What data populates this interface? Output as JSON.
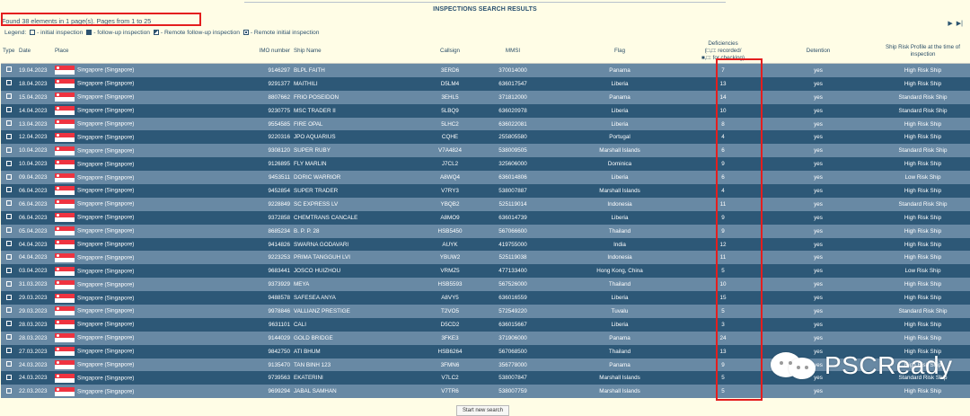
{
  "page_title": "INSPECTIONS SEARCH RESULTS",
  "summary": "Found 38 elements in 1 page(s). Pages from 1 to 25",
  "pager": {
    "next": "▶",
    "last": "▶|"
  },
  "legend": {
    "prefix": "Legend:",
    "items": [
      "- initial inspection",
      "- follow-up inspection",
      "- Remote follow-up inspection",
      "- Remote initial inspection"
    ]
  },
  "headers": {
    "type": "Type",
    "date": "Date",
    "place": "Place",
    "imo": "IMO number",
    "ship": "Ship Name",
    "callsign": "Callsign",
    "mmsi": "MMSI",
    "flag": "Flag",
    "deficiencies_1": "Deficiencies",
    "deficiencies_2": "(□,□: recorded/",
    "deficiencies_3": "■,□: for checking)",
    "detention": "Detention",
    "risk": "Ship Risk Profile at the time of inspection"
  },
  "rows": [
    {
      "date": "19.04.2023",
      "place": "Singapore (Singapore)",
      "imo": "9146297",
      "ship": "BLPL FAITH",
      "callsign": "3ERD6",
      "mmsi": "370014000",
      "flag": "Panama",
      "deficiencies": "7",
      "detention": "yes",
      "risk": "High Risk Ship"
    },
    {
      "date": "18.04.2023",
      "place": "Singapore (Singapore)",
      "imo": "9291377",
      "ship": "MAITHILI",
      "callsign": "D5LM4",
      "mmsi": "636017547",
      "flag": "Liberia",
      "deficiencies": "13",
      "detention": "yes",
      "risk": "High Risk Ship"
    },
    {
      "date": "15.04.2023",
      "place": "Singapore (Singapore)",
      "imo": "8807662",
      "ship": "FRIO POSEIDON",
      "callsign": "3EHL5",
      "mmsi": "371812000",
      "flag": "Panama",
      "deficiencies": "14",
      "detention": "yes",
      "risk": "Standard Risk Ship"
    },
    {
      "date": "14.04.2023",
      "place": "Singapore (Singapore)",
      "imo": "9230775",
      "ship": "MSC TRADER II",
      "callsign": "5LBQ9",
      "mmsi": "636020978",
      "flag": "Liberia",
      "deficiencies": "10",
      "detention": "yes",
      "risk": "Standard Risk Ship"
    },
    {
      "date": "13.04.2023",
      "place": "Singapore (Singapore)",
      "imo": "9554585",
      "ship": "FIRE OPAL",
      "callsign": "5LHC2",
      "mmsi": "636022081",
      "flag": "Liberia",
      "deficiencies": "8",
      "detention": "yes",
      "risk": "High Risk Ship"
    },
    {
      "date": "12.04.2023",
      "place": "Singapore (Singapore)",
      "imo": "9220316",
      "ship": "JPO AQUARIUS",
      "callsign": "CQHE",
      "mmsi": "255805580",
      "flag": "Portugal",
      "deficiencies": "4",
      "detention": "yes",
      "risk": "High Risk Ship"
    },
    {
      "date": "10.04.2023",
      "place": "Singapore (Singapore)",
      "imo": "9308120",
      "ship": "SUPER RUBY",
      "callsign": "V7A4824",
      "mmsi": "538009505",
      "flag": "Marshall Islands",
      "deficiencies": "6",
      "detention": "yes",
      "risk": "Standard Risk Ship"
    },
    {
      "date": "10.04.2023",
      "place": "Singapore (Singapore)",
      "imo": "9126895",
      "ship": "FLY MARLIN",
      "callsign": "J7CL2",
      "mmsi": "325606000",
      "flag": "Dominica",
      "deficiencies": "9",
      "detention": "yes",
      "risk": "High Risk Ship"
    },
    {
      "date": "09.04.2023",
      "place": "Singapore (Singapore)",
      "imo": "9453511",
      "ship": "DORIC WARRIOR",
      "callsign": "A8WQ4",
      "mmsi": "636014806",
      "flag": "Liberia",
      "deficiencies": "6",
      "detention": "yes",
      "risk": "Low Risk Ship"
    },
    {
      "date": "06.04.2023",
      "place": "Singapore (Singapore)",
      "imo": "9452854",
      "ship": "SUPER TRADER",
      "callsign": "V7RY3",
      "mmsi": "538007887",
      "flag": "Marshall Islands",
      "deficiencies": "4",
      "detention": "yes",
      "risk": "High Risk Ship"
    },
    {
      "date": "06.04.2023",
      "place": "Singapore (Singapore)",
      "imo": "9228849",
      "ship": "SC EXPRESS LV",
      "callsign": "YBQB2",
      "mmsi": "525119014",
      "flag": "Indonesia",
      "deficiencies": "11",
      "detention": "yes",
      "risk": "Standard Risk Ship"
    },
    {
      "date": "06.04.2023",
      "place": "Singapore (Singapore)",
      "imo": "9372858",
      "ship": "CHEMTRANS CANCALE",
      "callsign": "A8MO9",
      "mmsi": "636014739",
      "flag": "Liberia",
      "deficiencies": "9",
      "detention": "yes",
      "risk": "High Risk Ship"
    },
    {
      "date": "05.04.2023",
      "place": "Singapore (Singapore)",
      "imo": "8685234",
      "ship": "B. P. P. 28",
      "callsign": "HSB5450",
      "mmsi": "567066600",
      "flag": "Thailand",
      "deficiencies": "9",
      "detention": "yes",
      "risk": "High Risk Ship"
    },
    {
      "date": "04.04.2023",
      "place": "Singapore (Singapore)",
      "imo": "9414826",
      "ship": "SWARNA GODAVARI",
      "callsign": "AUYK",
      "mmsi": "419755000",
      "flag": "India",
      "deficiencies": "12",
      "detention": "yes",
      "risk": "High Risk Ship"
    },
    {
      "date": "04.04.2023",
      "place": "Singapore (Singapore)",
      "imo": "9223253",
      "ship": "PRIMA TANGGUH LVI",
      "callsign": "YBUW2",
      "mmsi": "525119038",
      "flag": "Indonesia",
      "deficiencies": "11",
      "detention": "yes",
      "risk": "High Risk Ship"
    },
    {
      "date": "03.04.2023",
      "place": "Singapore (Singapore)",
      "imo": "9683441",
      "ship": "JOSCO HUIZHOU",
      "callsign": "VRMZ5",
      "mmsi": "477133400",
      "flag": "Hong Kong, China",
      "deficiencies": "5",
      "detention": "yes",
      "risk": "Low Risk Ship"
    },
    {
      "date": "31.03.2023",
      "place": "Singapore (Singapore)",
      "imo": "9373929",
      "ship": "MEYA",
      "callsign": "HSB5593",
      "mmsi": "567526000",
      "flag": "Thailand",
      "deficiencies": "10",
      "detention": "yes",
      "risk": "High Risk Ship"
    },
    {
      "date": "29.03.2023",
      "place": "Singapore (Singapore)",
      "imo": "9488578",
      "ship": "SAFESEA ANYA",
      "callsign": "A8VY5",
      "mmsi": "636016559",
      "flag": "Liberia",
      "deficiencies": "15",
      "detention": "yes",
      "risk": "High Risk Ship"
    },
    {
      "date": "29.03.2023",
      "place": "Singapore (Singapore)",
      "imo": "9978846",
      "ship": "VALLIANZ PRESTIGE",
      "callsign": "T2VO5",
      "mmsi": "572549220",
      "flag": "Tuvalu",
      "deficiencies": "5",
      "detention": "yes",
      "risk": "Standard Risk Ship"
    },
    {
      "date": "28.03.2023",
      "place": "Singapore (Singapore)",
      "imo": "9631101",
      "ship": "CALI",
      "callsign": "D5CD2",
      "mmsi": "636015667",
      "flag": "Liberia",
      "deficiencies": "3",
      "detention": "yes",
      "risk": "High Risk Ship"
    },
    {
      "date": "28.03.2023",
      "place": "Singapore (Singapore)",
      "imo": "9144029",
      "ship": "GOLD BRIDGE",
      "callsign": "3FKE3",
      "mmsi": "371906000",
      "flag": "Panama",
      "deficiencies": "24",
      "detention": "yes",
      "risk": "High Risk Ship"
    },
    {
      "date": "27.03.2023",
      "place": "Singapore (Singapore)",
      "imo": "9842750",
      "ship": "ATI BHUM",
      "callsign": "HSB6264",
      "mmsi": "567068500",
      "flag": "Thailand",
      "deficiencies": "13",
      "detention": "yes",
      "risk": "High Risk Ship"
    },
    {
      "date": "24.03.2023",
      "place": "Singapore (Singapore)",
      "imo": "9135470",
      "ship": "TAN BINH 123",
      "callsign": "3FMN6",
      "mmsi": "356778000",
      "flag": "Panama",
      "deficiencies": "9",
      "detention": "yes",
      "risk": "High Risk Ship"
    },
    {
      "date": "24.03.2023",
      "place": "Singapore (Singapore)",
      "imo": "9739563",
      "ship": "EKATERINI",
      "callsign": "V7LC2",
      "mmsi": "538007847",
      "flag": "Marshall Islands",
      "deficiencies": "5",
      "detention": "yes",
      "risk": "Standard Risk Ship"
    },
    {
      "date": "22.03.2023",
      "place": "Singapore (Singapore)",
      "imo": "9699294",
      "ship": "JABAL SAMHAN",
      "callsign": "V7TR6",
      "mmsi": "538007759",
      "flag": "Marshall Islands",
      "deficiencies": "5",
      "detention": "yes",
      "risk": "High Risk Ship"
    }
  ],
  "start_new_search": "Start new search",
  "watermark": "PSCReady",
  "colors": {
    "row_odd": "#6889a4",
    "row_even": "#2d5877",
    "highlight": "#e41e1e",
    "background": "#fffde6"
  }
}
